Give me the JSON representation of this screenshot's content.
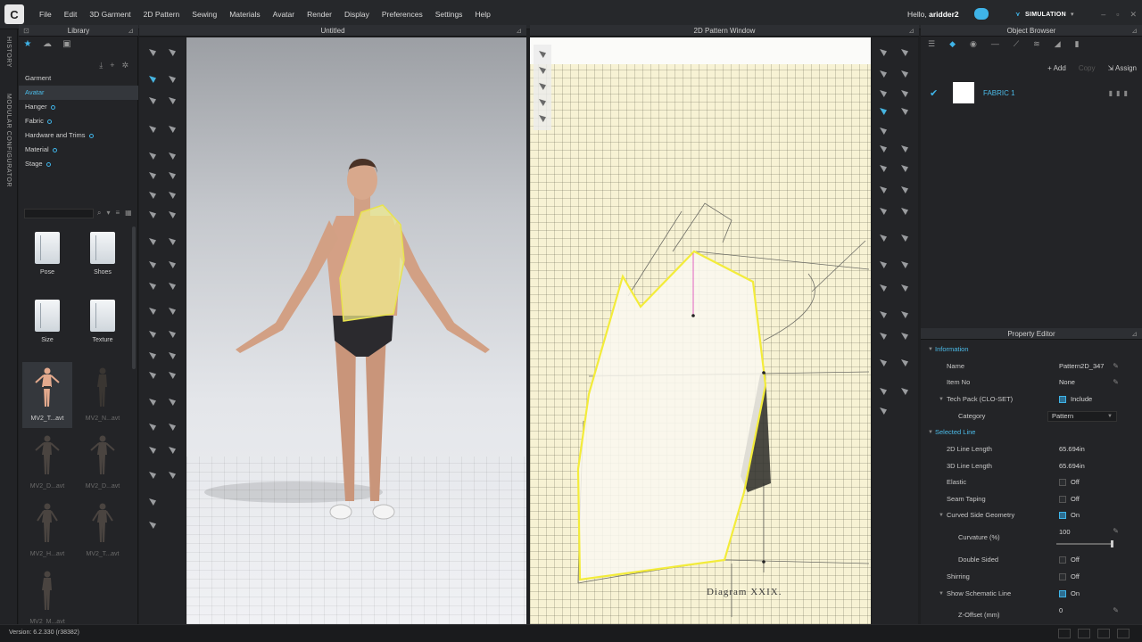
{
  "app": {
    "logo": "C",
    "menu": [
      "File",
      "Edit",
      "3D Garment",
      "2D Pattern",
      "Sewing",
      "Materials",
      "Avatar",
      "Render",
      "Display",
      "Preferences",
      "Settings",
      "Help"
    ],
    "greeting_prefix": "Hello,",
    "username": "aridder2",
    "mode": "SIMULATION",
    "accent_color": "#3fb4e8"
  },
  "left_strip": {
    "history": "HISTORY",
    "modular": "MODULAR CONFIGURATOR"
  },
  "library": {
    "title": "Library",
    "items": [
      {
        "label": "Garment",
        "dot": false
      },
      {
        "label": "Avatar",
        "dot": false,
        "selected": true
      },
      {
        "label": "Hanger",
        "dot": true
      },
      {
        "label": "Fabric",
        "dot": true
      },
      {
        "label": "Hardware and Trims",
        "dot": true
      },
      {
        "label": "Material",
        "dot": true
      },
      {
        "label": "Stage",
        "dot": true
      }
    ],
    "folders": [
      "Pose",
      "Shoes",
      "Size",
      "Texture"
    ],
    "avatars": [
      "MV2_T...avt",
      "MV2_N...avt",
      "MV2_D...avt",
      "MV2_D...avt",
      "MV2_H...avt",
      "MV2_T...avt",
      "MV2_M...avt"
    ]
  },
  "viewport_3d": {
    "title": "Untitled"
  },
  "pattern_window": {
    "title": "2D Pattern Window",
    "caption": "Diagram XXIX."
  },
  "object_browser": {
    "title": "Object Browser",
    "add_label": "Add",
    "copy_label": "Copy",
    "assign_label": "Assign",
    "fabric_name": "FABRIC 1",
    "fabric_color": "#ffffff"
  },
  "property_editor": {
    "title": "Property Editor",
    "information": "Information",
    "name_label": "Name",
    "name_value": "Pattern2D_347",
    "item_no_label": "Item No",
    "item_no_value": "None",
    "tech_pack_label": "Tech Pack (CLO-SET)",
    "tech_pack_value": "Include",
    "category_label": "Category",
    "category_value": "Pattern",
    "selected_line": "Selected Line",
    "line2d_label": "2D Line Length",
    "line2d_value": "65.694in",
    "line3d_label": "3D Line Length",
    "line3d_value": "65.694in",
    "elastic_label": "Elastic",
    "elastic_value": "Off",
    "seam_taping_label": "Seam Taping",
    "seam_taping_value": "Off",
    "curved_label": "Curved Side Geometry",
    "curved_value": "On",
    "curvature_label": "Curvature (%)",
    "curvature_value": "100",
    "double_sided_label": "Double Sided",
    "double_sided_value": "Off",
    "shirring_label": "Shirring",
    "shirring_value": "Off",
    "schematic_label": "Show Schematic Line",
    "schematic_value": "On",
    "zoffset_label": "Z-Offset (mm)",
    "zoffset_value": "0"
  },
  "status": {
    "version": "Version: 6.2.330 (r38382)"
  }
}
